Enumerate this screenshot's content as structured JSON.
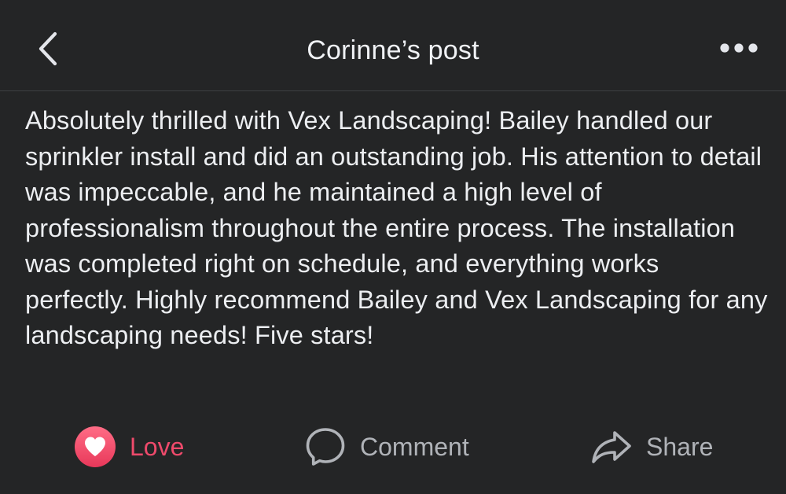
{
  "header": {
    "title": "Corinne’s post",
    "back_icon": "chevron-left-icon",
    "more_icon": "more-horizontal-icon"
  },
  "post": {
    "text": "Absolutely thrilled with Vex Landscaping! Bailey handled our sprinkler install and did an outstanding job. His attention to detail was impeccable, and he maintained a high level of professionalism throughout the entire process. The installation was completed right on schedule, and everything works perfectly. Highly recommend Bailey and Vex Landscaping for any landscaping needs! Five stars!"
  },
  "actions": {
    "love": {
      "label": "Love",
      "icon": "heart-icon",
      "color": "#ee4a6b"
    },
    "comment": {
      "label": "Comment",
      "icon": "speech-bubble-icon"
    },
    "share": {
      "label": "Share",
      "icon": "share-arrow-icon"
    }
  },
  "colors": {
    "background": "#242526",
    "text": "#e4e6eb",
    "muted": "#b0b3b8",
    "accent_love": "#ee4a6b"
  }
}
